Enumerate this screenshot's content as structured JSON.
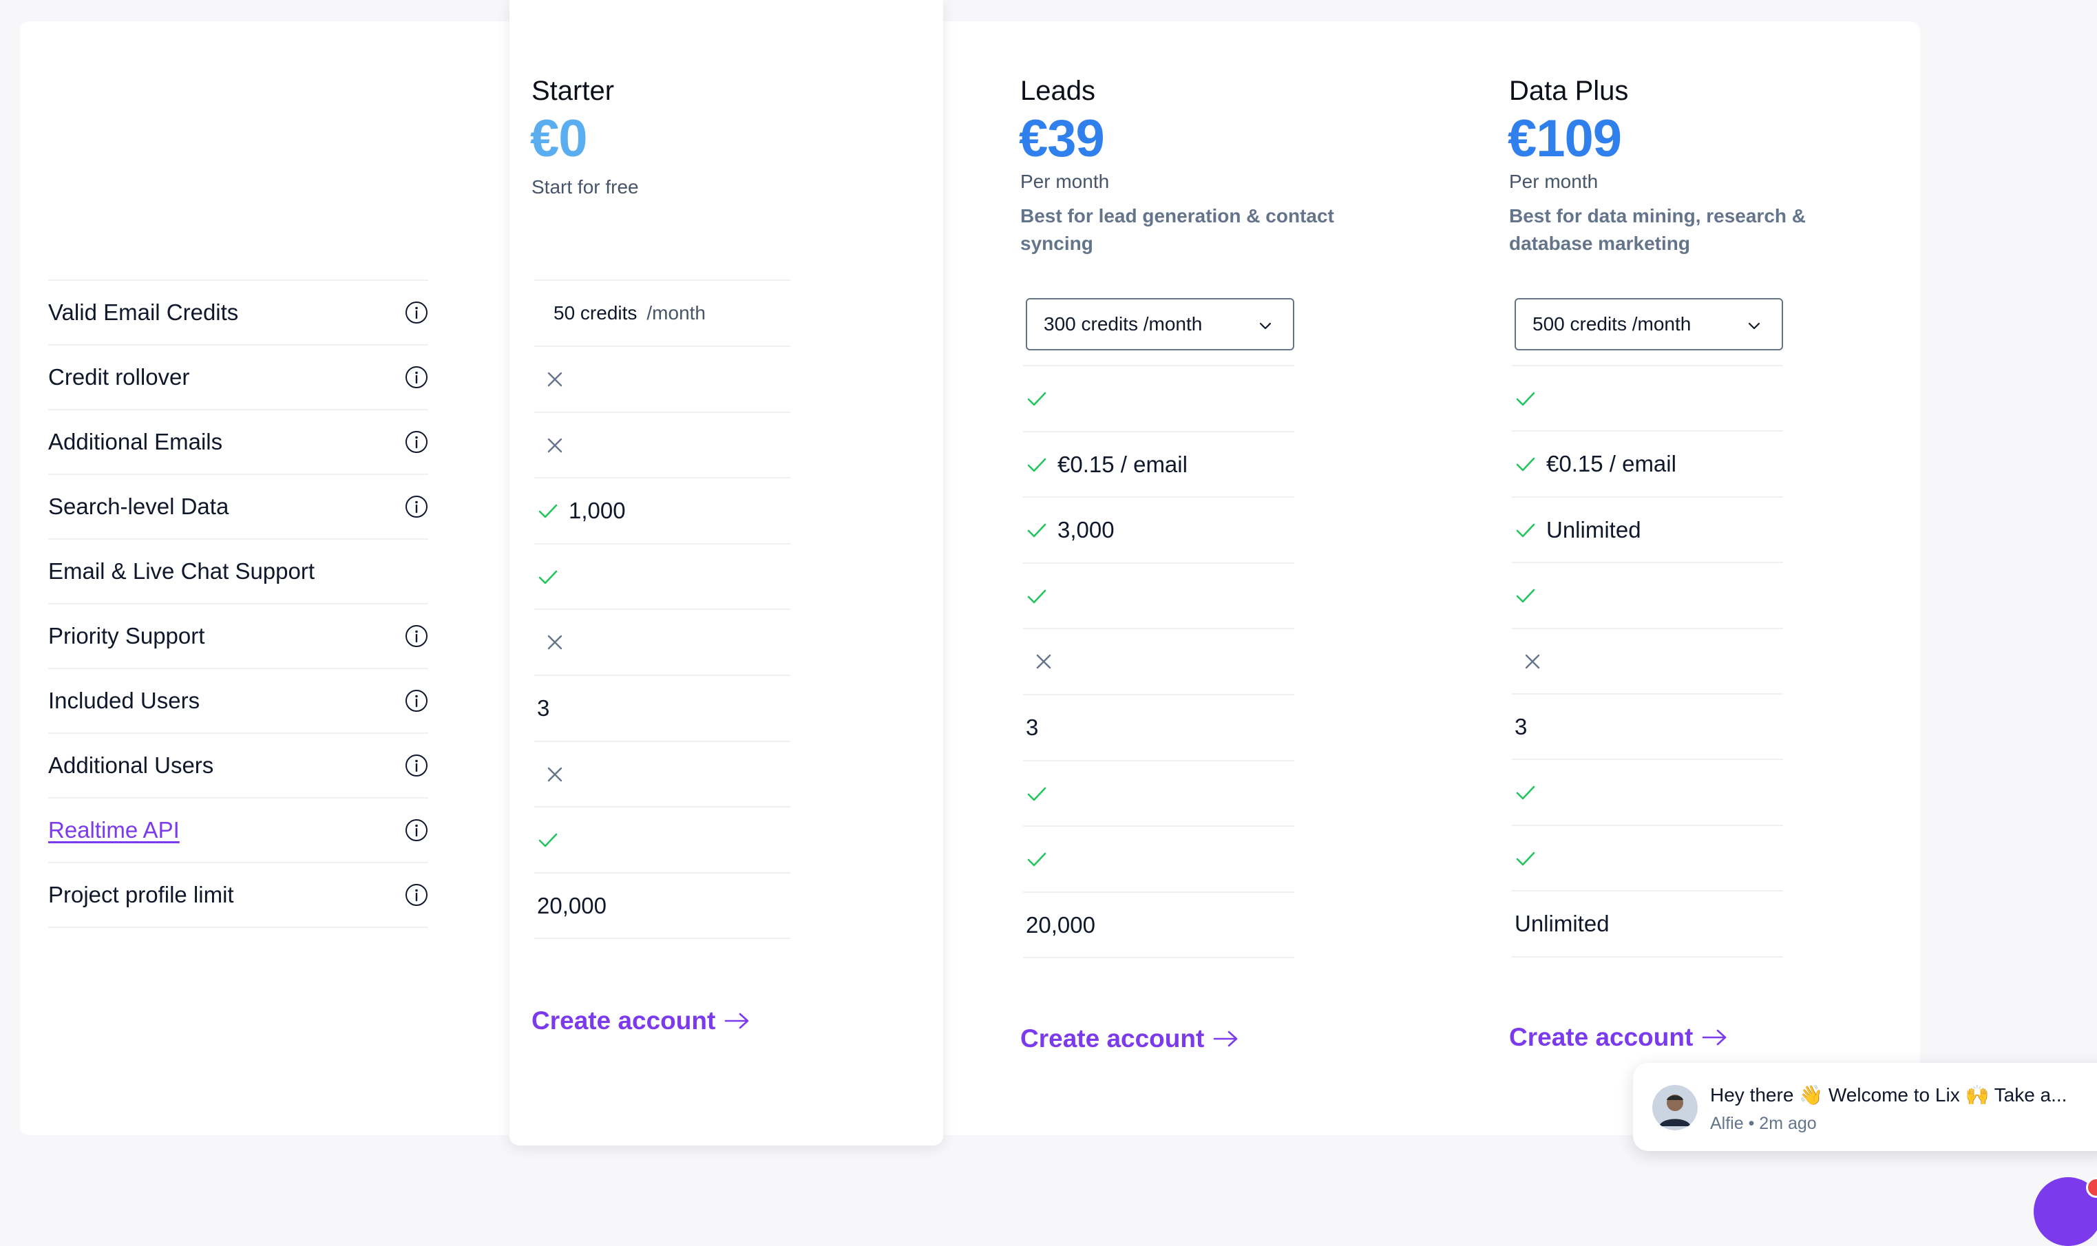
{
  "features": [
    {
      "label": "Valid Email Credits",
      "info": true,
      "link": false
    },
    {
      "label": "Credit rollover",
      "info": true,
      "link": false
    },
    {
      "label": "Additional Emails",
      "info": true,
      "link": false
    },
    {
      "label": "Search-level Data",
      "info": true,
      "link": false
    },
    {
      "label": "Email & Live Chat Support",
      "info": false,
      "link": false
    },
    {
      "label": "Priority Support",
      "info": true,
      "link": false
    },
    {
      "label": "Included Users",
      "info": true,
      "link": false
    },
    {
      "label": "Additional Users",
      "info": true,
      "link": false
    },
    {
      "label": "Realtime API",
      "info": true,
      "link": true
    },
    {
      "label": "Project profile limit",
      "info": true,
      "link": false
    }
  ],
  "plans": [
    {
      "name": "Starter",
      "price": "€0",
      "price_color": "#5aaef0",
      "subtitle": "Start for free",
      "description": "",
      "credits": {
        "type": "static",
        "amount": "50 credits",
        "unit": "/month"
      },
      "values": [
        {
          "icon": "cross",
          "text": ""
        },
        {
          "icon": "cross",
          "text": ""
        },
        {
          "icon": "check",
          "text": "1,000"
        },
        {
          "icon": "check",
          "text": ""
        },
        {
          "icon": "cross",
          "text": ""
        },
        {
          "icon": "none",
          "text": "3"
        },
        {
          "icon": "cross",
          "text": ""
        },
        {
          "icon": "check",
          "text": ""
        },
        {
          "icon": "none",
          "text": "20,000"
        }
      ],
      "cta": "Create account"
    },
    {
      "name": "Leads",
      "price": "€39",
      "price_color": "#2f80ed",
      "subtitle": "Per month",
      "description": "Best for lead generation & contact syncing",
      "credits": {
        "type": "select",
        "value": "300 credits /month"
      },
      "values": [
        {
          "icon": "check",
          "text": ""
        },
        {
          "icon": "check",
          "text": "€0.15 / email"
        },
        {
          "icon": "check",
          "text": "3,000"
        },
        {
          "icon": "check",
          "text": ""
        },
        {
          "icon": "cross",
          "text": ""
        },
        {
          "icon": "none",
          "text": "3"
        },
        {
          "icon": "check",
          "text": ""
        },
        {
          "icon": "check",
          "text": ""
        },
        {
          "icon": "none",
          "text": "20,000"
        }
      ],
      "cta": "Create account"
    },
    {
      "name": "Data Plus",
      "price": "€109",
      "price_color": "#2f80ed",
      "subtitle": "Per month",
      "description": "Best for data mining, research & database marketing",
      "credits": {
        "type": "select",
        "value": "500 credits /month"
      },
      "values": [
        {
          "icon": "check",
          "text": ""
        },
        {
          "icon": "check",
          "text": "€0.15 / email"
        },
        {
          "icon": "check",
          "text": "Unlimited"
        },
        {
          "icon": "check",
          "text": ""
        },
        {
          "icon": "cross",
          "text": ""
        },
        {
          "icon": "none",
          "text": "3"
        },
        {
          "icon": "check",
          "text": ""
        },
        {
          "icon": "check",
          "text": ""
        },
        {
          "icon": "none",
          "text": "Unlimited"
        }
      ],
      "cta": "Create account"
    }
  ],
  "chat": {
    "message": "Hey there 👋 Welcome to Lix 🙌 Take a...",
    "author": "Alfie",
    "time": "2m ago"
  },
  "colors": {
    "accent": "#7c3aed",
    "check": "#22c55e",
    "cross": "#64748b"
  }
}
